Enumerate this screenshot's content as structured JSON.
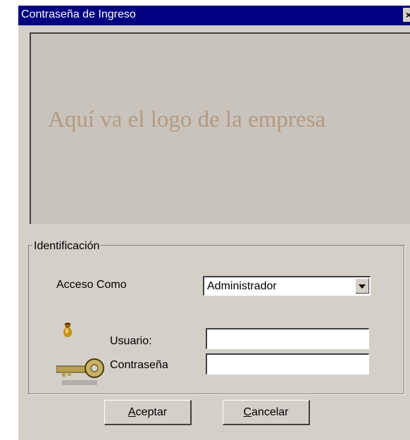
{
  "window": {
    "title": "Contraseña de Ingreso",
    "close_glyph": "×"
  },
  "logo": {
    "placeholder_text": "Aquí va el logo de la empresa"
  },
  "identification": {
    "legend": "Identificación",
    "access_label": "Acceso Como",
    "access_value": "Administrador",
    "user_label": "Usuario:",
    "user_value": "",
    "password_label": "Contraseña",
    "password_value": ""
  },
  "buttons": {
    "accept": {
      "mnemonic": "A",
      "rest": "ceptar"
    },
    "cancel": {
      "mnemonic": "C",
      "rest": "ancelar"
    }
  },
  "icons": {
    "user": "user-icon",
    "key": "key-icon",
    "dropdown": "chevron-down-icon",
    "close": "close-icon"
  },
  "colors": {
    "titlebar": "#000080",
    "dialog_face": "#d4d0c8",
    "logo_text": "#b39a80"
  }
}
